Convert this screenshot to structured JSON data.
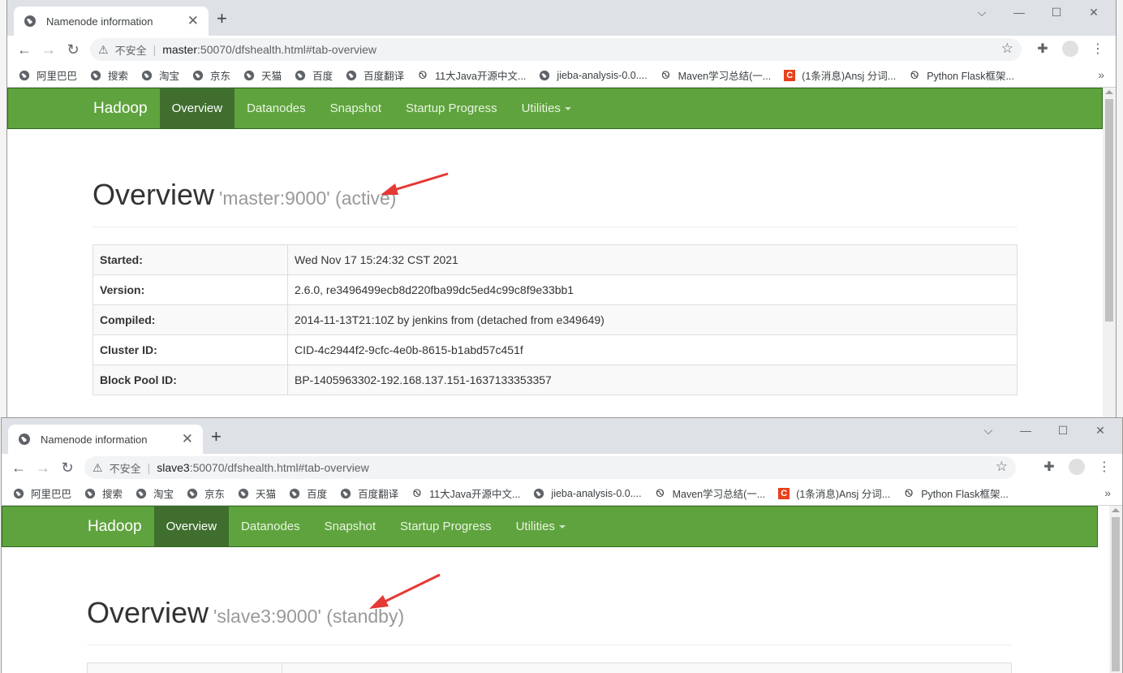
{
  "desktop": {
    "left_marks": [
      "",
      "",
      "",
      "",
      ""
    ]
  },
  "window1": {
    "tab_title": "Namenode information",
    "security_label": "不安全",
    "url_host": "master",
    "url_path": ":50070/dfshealth.html#tab-overview",
    "navbar": {
      "brand": "Hadoop",
      "items": [
        "Overview",
        "Datanodes",
        "Snapshot",
        "Startup Progress",
        "Utilities"
      ]
    },
    "overview": {
      "title": "Overview",
      "subtitle": "'master:9000' (active)"
    },
    "info_rows": [
      {
        "label": "Started:",
        "value": "Wed Nov 17 15:24:32 CST 2021"
      },
      {
        "label": "Version:",
        "value": "2.6.0, re3496499ecb8d220fba99dc5ed4c99c8f9e33bb1"
      },
      {
        "label": "Compiled:",
        "value": "2014-11-13T21:10Z by jenkins from (detached from e349649)"
      },
      {
        "label": "Cluster ID:",
        "value": "CID-4c2944f2-9cfc-4e0b-8615-b1abd57c451f"
      },
      {
        "label": "Block Pool ID:",
        "value": "BP-1405963302-192.168.137.151-1637133353357"
      }
    ]
  },
  "window2": {
    "tab_title": "Namenode information",
    "security_label": "不安全",
    "url_host": "slave3",
    "url_path": ":50070/dfshealth.html#tab-overview",
    "navbar": {
      "brand": "Hadoop",
      "items": [
        "Overview",
        "Datanodes",
        "Snapshot",
        "Startup Progress",
        "Utilities"
      ]
    },
    "overview": {
      "title": "Overview",
      "subtitle": "'slave3:9000' (standby)"
    }
  },
  "bookmarks": [
    {
      "label": "阿里巴巴",
      "icon": "globe-icon"
    },
    {
      "label": "搜索",
      "icon": "globe-icon"
    },
    {
      "label": "淘宝",
      "icon": "globe-icon"
    },
    {
      "label": "京东",
      "icon": "globe-icon"
    },
    {
      "label": "天猫",
      "icon": "globe-icon"
    },
    {
      "label": "百度",
      "icon": "globe-icon"
    },
    {
      "label": "百度翻译",
      "icon": "globe-icon"
    },
    {
      "label": "11大Java开源中文...",
      "icon": "ansj-icon"
    },
    {
      "label": "jieba-analysis-0.0....",
      "icon": "globe-icon"
    },
    {
      "label": "Maven学习总结(一...",
      "icon": "ansj-icon"
    },
    {
      "label": "(1条消息)Ansj 分词...",
      "icon": "csdn-icon"
    },
    {
      "label": "Python Flask框架...",
      "icon": "ansj-icon"
    }
  ],
  "colors": {
    "navbar_bg": "#5fa33e",
    "navbar_active": "#3f6e2e",
    "arrow": "#e53935"
  }
}
